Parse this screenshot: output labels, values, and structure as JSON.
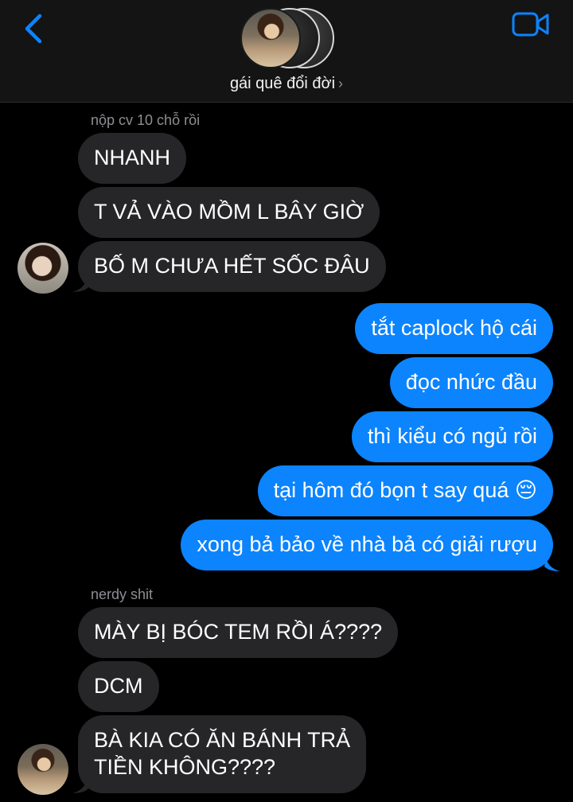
{
  "header": {
    "group_name": "gái quê đổi đời",
    "chevron": "›",
    "back_icon": "chevron-left-icon",
    "video_icon": "video-camera-icon",
    "accent": "#0b84fe"
  },
  "messages": [
    {
      "sender_label": "nộp cv 10 chỗ rồi"
    },
    {
      "from": "in",
      "text": "NHANH"
    },
    {
      "from": "in",
      "text": "T VẢ VÀO MỒM L BÂY GIỜ"
    },
    {
      "from": "in",
      "text": "BỐ M CHƯA HẾT SỐC ĐÂU"
    },
    {
      "from": "out",
      "text": "tắt caplock hộ cái"
    },
    {
      "from": "out",
      "text": "đọc nhức đầu"
    },
    {
      "from": "out",
      "text": "thì kiểu có ngủ rồi"
    },
    {
      "from": "out",
      "text": "tại hôm đó bọn t say quá 😔"
    },
    {
      "from": "out",
      "text": "xong bả bảo về nhà bả có giải rượu"
    },
    {
      "sender_label": "nerdy shit"
    },
    {
      "from": "in",
      "text": "MÀY BỊ BÓC TEM RỒI Á????"
    },
    {
      "from": "in",
      "text": "DCM"
    },
    {
      "from": "in",
      "text": "BÀ KIA CÓ ĂN BÁNH TRẢ\nTIỀN KHÔNG????"
    }
  ],
  "colors": {
    "incoming_bubble": "#262628",
    "outgoing_bubble": "#0b84fe",
    "background": "#000000"
  }
}
